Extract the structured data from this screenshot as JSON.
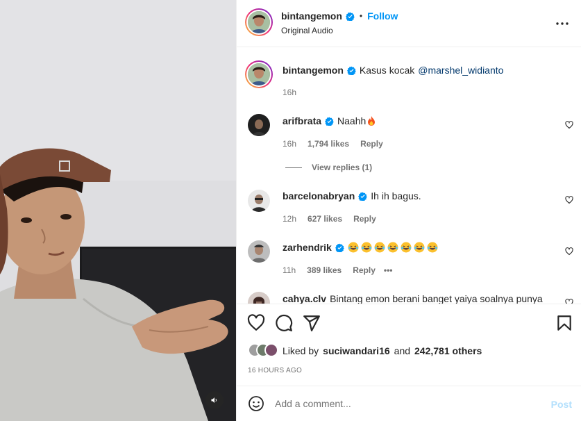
{
  "post": {
    "author": "bintangemon",
    "follow_label": "Follow",
    "audio": "Original Audio",
    "dot": "•"
  },
  "caption": {
    "username": "bintangemon",
    "text": "Kasus kocak",
    "mention": "@marshel_widianto",
    "time": "16h"
  },
  "comments": [
    {
      "username": "arifbrata",
      "verified": true,
      "text": "Naahh",
      "emoji": "fire-emoji",
      "time": "16h",
      "likes": "1,794 likes",
      "reply": "Reply"
    },
    {
      "username": "barcelonabryan",
      "verified": true,
      "text": "Ih ih bagus.",
      "time": "12h",
      "likes": "627 likes",
      "reply": "Reply"
    },
    {
      "username": "zarhendrik",
      "verified": true,
      "emoji_count": 7,
      "emoji": "laughing-emoji",
      "time": "11h",
      "likes": "389 likes",
      "reply": "Reply",
      "more": "•••"
    },
    {
      "username": "cahya.clv",
      "text": "Bintang emon berani banget yaiya soalnya punya"
    }
  ],
  "view_replies": "View replies (1)",
  "likes": {
    "liked_by_prefix": "Liked by",
    "liked_by_user": "suciwandari16",
    "and": "and",
    "others": "242,781 others"
  },
  "timestamp": "16 HOURS AGO",
  "add_comment": {
    "placeholder": "Add a comment...",
    "post_label": "Post"
  },
  "colors": {
    "accent": "#0095f6",
    "mention": "#00376b",
    "secondary_text": "#737373",
    "post_disabled": "#b2dffc",
    "verified": "#0095f6"
  },
  "icons": [
    "heart-icon",
    "comment-icon",
    "share-icon",
    "bookmark-icon",
    "more-icon",
    "smile-icon",
    "mute-icon",
    "verified-icon"
  ]
}
